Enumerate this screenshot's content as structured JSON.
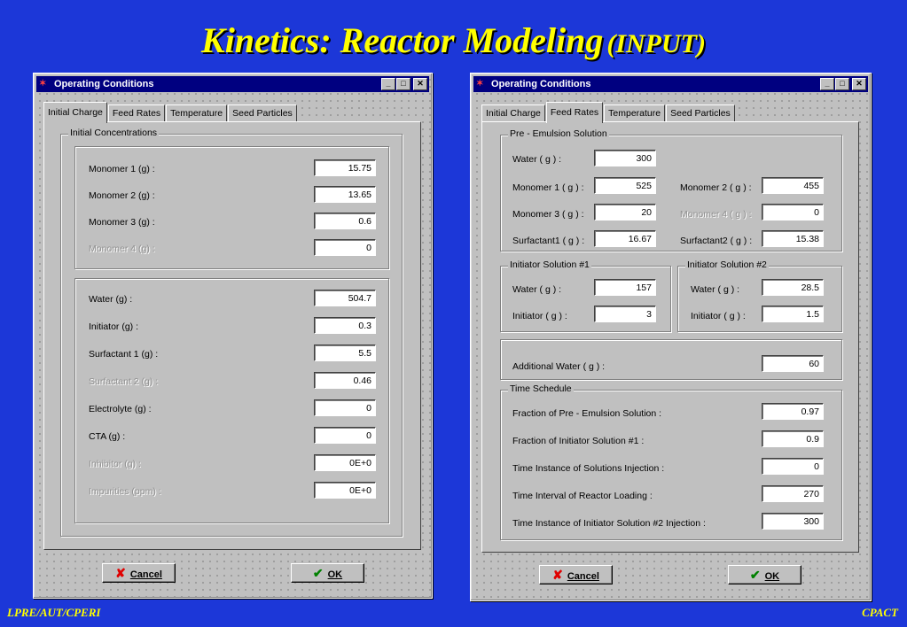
{
  "slide": {
    "title": "Kinetics: Reactor Modeling",
    "subtitle": "(INPUT)",
    "footer_left": "LPRE/AUT/CPERI",
    "footer_right": "CPACT"
  },
  "window_title": "Operating Conditions",
  "tabs": [
    "Initial Charge",
    "Feed Rates",
    "Temperature",
    "Seed Particles"
  ],
  "buttons": {
    "cancel": "Cancel",
    "ok": "OK"
  },
  "left": {
    "active_tab": "Initial Charge",
    "group_title": "Initial Concentrations",
    "monomers": [
      {
        "label": "Monomer 1  (g) :",
        "value": "15.75",
        "disabled": false
      },
      {
        "label": "Monomer 2  (g) :",
        "value": "13.65",
        "disabled": false
      },
      {
        "label": "Monomer 3  (g) :",
        "value": "0.6",
        "disabled": false
      },
      {
        "label": "Monomer 4  (g) :",
        "value": "0",
        "disabled": true
      }
    ],
    "others": [
      {
        "label": "Water  (g) :",
        "value": "504.7",
        "disabled": false
      },
      {
        "label": "Initiator   (g) :",
        "value": "0.3",
        "disabled": false
      },
      {
        "label": "Surfactant 1 (g) :",
        "value": "5.5",
        "disabled": false
      },
      {
        "label": "Surfactant 2 (g) :",
        "value": "0.46",
        "disabled": true
      },
      {
        "label": "Electrolyte  (g) :",
        "value": "0",
        "disabled": false
      },
      {
        "label": "CTA  (g) :",
        "value": "0",
        "disabled": false
      },
      {
        "label": "Inhibitor  (g) :",
        "value": "0E+0",
        "disabled": true
      },
      {
        "label": "Impurities  (ppm) :",
        "value": "0E+0",
        "disabled": true
      }
    ]
  },
  "right": {
    "active_tab": "Feed Rates",
    "pre_emulsion": {
      "title": "Pre - Emulsion Solution",
      "water_label": "Water ( g ) :",
      "water": "300",
      "m1_label": "Monomer 1  ( g ) :",
      "m1": "525",
      "m2_label": "Monomer 2  ( g ) :",
      "m2": "455",
      "m3_label": "Monomer 3  ( g ) :",
      "m3": "20",
      "m4_label": "Monomer 4  ( g ) :",
      "m4": "0",
      "s1_label": "Surfactant1  ( g ) :",
      "s1": "16.67",
      "s2_label": "Surfactant2  ( g ) :",
      "s2": "15.38"
    },
    "init1": {
      "title": "Initiator Solution #1",
      "water_label": "Water  ( g ) :",
      "water": "157",
      "init_label": "Initiator   ( g ) :",
      "init": "3"
    },
    "init2": {
      "title": "Initiator Solution #2",
      "water_label": "Water  ( g ) :",
      "water": "28.5",
      "init_label": "Initiator   ( g ) :",
      "init": "1.5"
    },
    "additional_water_label": "Additional Water  ( g ) :",
    "additional_water": "60",
    "schedule": {
      "title": "Time Schedule",
      "rows": [
        {
          "label": "Fraction of Pre - Emulsion Solution  :",
          "value": "0.97"
        },
        {
          "label": "Fraction of Initiator Solution #1 :",
          "value": "0.9"
        },
        {
          "label": "Time Instance of Solutions Injection  :",
          "value": "0"
        },
        {
          "label": "Time Interval of Reactor Loading  :",
          "value": "270"
        },
        {
          "label": "Time Instance of Initiator Solution #2 Injection  :",
          "value": "300"
        }
      ]
    }
  }
}
